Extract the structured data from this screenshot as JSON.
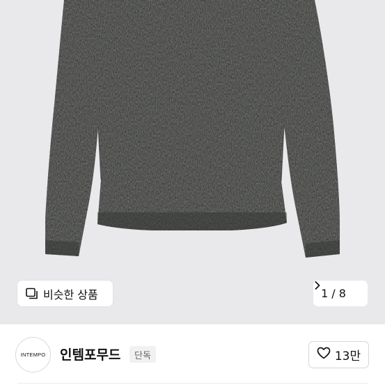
{
  "image_viewer": {
    "similar_label": "비슷한 상품",
    "current_page": "1",
    "separator": "/",
    "total_pages": "8"
  },
  "shop": {
    "logo_text": "INTEMPO",
    "name": "인템포무드",
    "badge": "단독",
    "like_count": "13만"
  },
  "icons": {
    "similar": "similar-products-icon",
    "next": "chevron-right-icon",
    "like": "heart-outline-icon"
  }
}
